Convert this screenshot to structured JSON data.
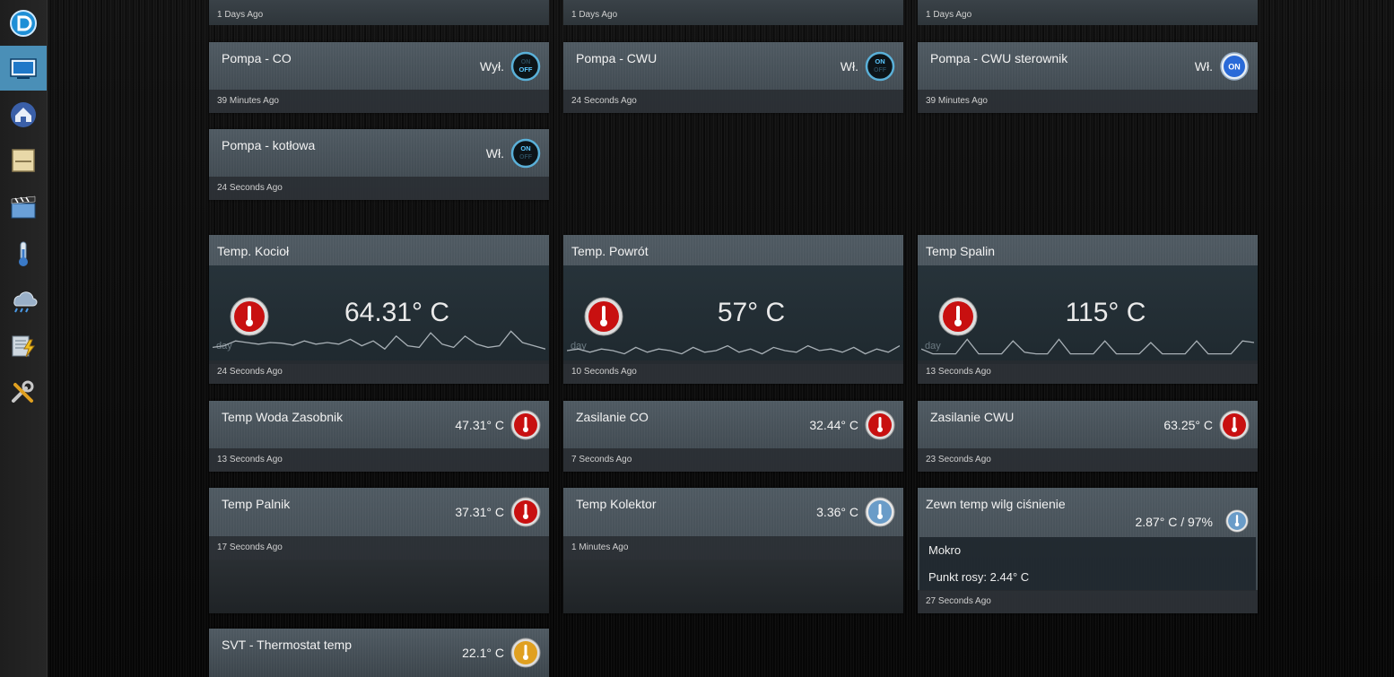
{
  "sidebar": {
    "items": [
      {
        "name": "logo-icon"
      },
      {
        "name": "dashboard-icon",
        "active": true
      },
      {
        "name": "floorplan-icon"
      },
      {
        "name": "switches-icon"
      },
      {
        "name": "scenes-icon"
      },
      {
        "name": "temperature-icon"
      },
      {
        "name": "weather-icon"
      },
      {
        "name": "utility-icon"
      },
      {
        "name": "setup-icon"
      }
    ]
  },
  "top_strips": [
    {
      "updated": "1 Days Ago"
    },
    {
      "updated": "1 Days Ago"
    },
    {
      "updated": "1 Days Ago"
    }
  ],
  "switches": [
    {
      "name": "Pompa - CO",
      "status": "Wył.",
      "updated": "39 Minutes Ago",
      "icon": "switch-off-icon"
    },
    {
      "name": "Pompa - CWU",
      "status": "Wł.",
      "updated": "24 Seconds Ago",
      "icon": "switch-onoff-icon"
    },
    {
      "name": "Pompa - CWU sterownik",
      "status": "Wł.",
      "updated": "39 Minutes Ago",
      "icon": "switch-on-icon"
    },
    {
      "name": "Pompa - kotłowa",
      "status": "Wł.",
      "updated": "24 Seconds Ago",
      "icon": "switch-onoff-icon"
    }
  ],
  "big_temps": [
    {
      "name": "Temp. Kocioł",
      "value": "64.31° C",
      "day_label": "day",
      "updated": "24 Seconds Ago",
      "spark": [
        0.35,
        0.4,
        0.55,
        0.5,
        0.45,
        0.5,
        0.48,
        0.42,
        0.55,
        0.45,
        0.5,
        0.45,
        0.6,
        0.4,
        0.55,
        0.3,
        0.7,
        0.4,
        0.35,
        0.8,
        0.45,
        0.35,
        0.7,
        0.45,
        0.35,
        0.4,
        0.85,
        0.5,
        0.4,
        0.3
      ]
    },
    {
      "name": "Temp. Powrót",
      "value": "57° C",
      "day_label": "day",
      "updated": "10 Seconds Ago",
      "spark": [
        0.25,
        0.3,
        0.2,
        0.3,
        0.25,
        0.15,
        0.35,
        0.2,
        0.3,
        0.25,
        0.15,
        0.35,
        0.2,
        0.25,
        0.4,
        0.2,
        0.3,
        0.15,
        0.35,
        0.25,
        0.2,
        0.4,
        0.25,
        0.3,
        0.2,
        0.35,
        0.15,
        0.3,
        0.2,
        0.4
      ]
    },
    {
      "name": "Temp Spalin",
      "value": "115° C",
      "day_label": "day",
      "updated": "13 Seconds Ago",
      "spark": [
        0.3,
        0.15,
        0.15,
        0.15,
        0.6,
        0.15,
        0.15,
        0.15,
        0.55,
        0.2,
        0.15,
        0.15,
        0.6,
        0.15,
        0.15,
        0.15,
        0.55,
        0.15,
        0.15,
        0.15,
        0.5,
        0.15,
        0.15,
        0.15,
        0.55,
        0.15,
        0.15,
        0.15,
        0.55,
        0.5
      ]
    }
  ],
  "temps": [
    {
      "name": "Temp Woda Zasobnik",
      "value": "47.31° C",
      "updated": "13 Seconds Ago",
      "icon": "thermometer-red-icon"
    },
    {
      "name": "Zasilanie CO",
      "value": "32.44° C",
      "updated": "7 Seconds Ago",
      "icon": "thermometer-red-icon"
    },
    {
      "name": "Zasilanie CWU",
      "value": "63.25° C",
      "updated": "23 Seconds Ago",
      "icon": "thermometer-red-icon"
    },
    {
      "name": "Temp Palnik",
      "value": "37.31° C",
      "updated": "17 Seconds Ago",
      "icon": "thermometer-red-icon"
    },
    {
      "name": "Temp Kolektor",
      "value": "3.36° C",
      "updated": "1 Minutes Ago",
      "icon": "thermometer-blue-icon"
    }
  ],
  "weather": {
    "name": "Zewn temp wilg ciśnienie",
    "value": "2.87° C / 97%",
    "row1": "Mokro",
    "row2": "Punkt rosy: 2.44° C",
    "updated": "27 Seconds Ago",
    "icon": "thermometer-blue-icon"
  },
  "thermostat": {
    "name": "SVT - Thermostat temp",
    "value": "22.1° C",
    "icon": "thermometer-yellow-icon"
  },
  "colors": {
    "accent": "#4a8fb7",
    "tile": "#48535b",
    "red": "#d01010",
    "blue": "#6a9cc8",
    "yellow": "#e0a020"
  }
}
